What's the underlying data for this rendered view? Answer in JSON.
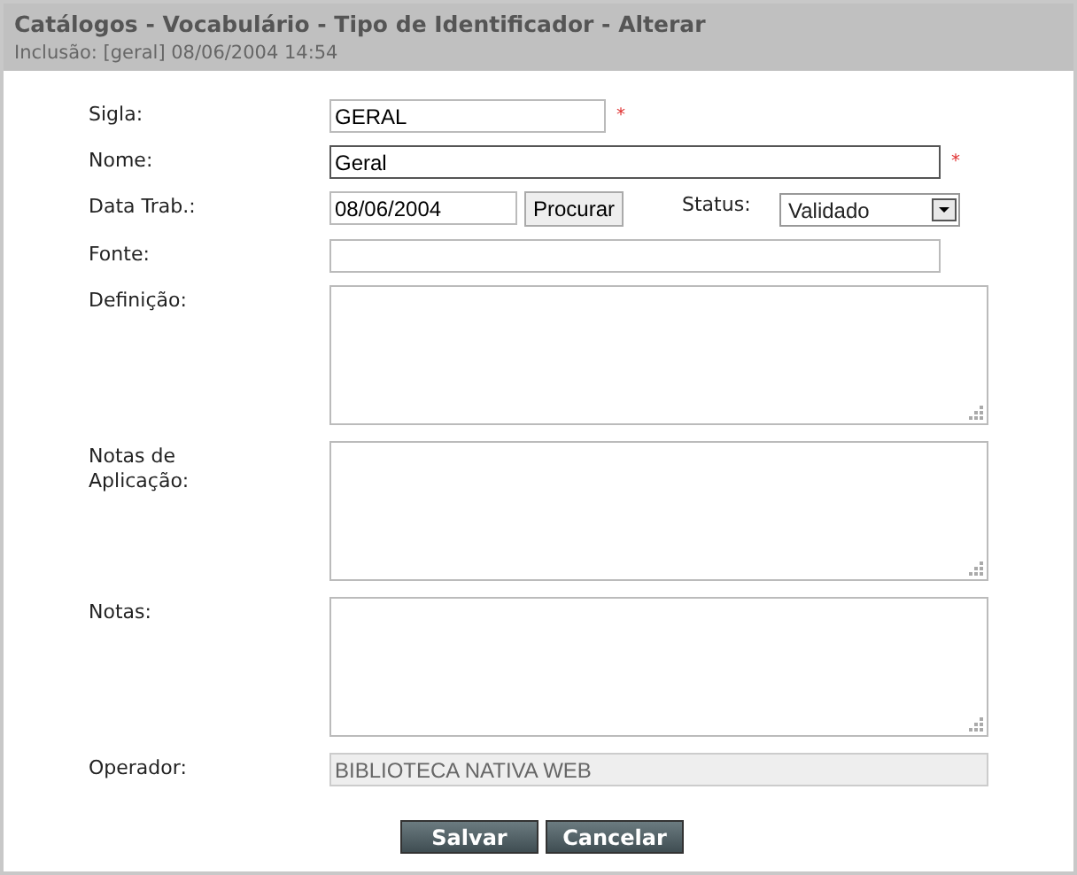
{
  "header": {
    "title": "Catálogos - Vocabulário - Tipo de Identificador - Alterar",
    "subtitle": "Inclusão: [geral] 08/06/2004 14:54"
  },
  "fields": [
    {
      "kind": "short",
      "label": "Sigla:",
      "value": "GERAL",
      "required": true,
      "required_mark": "*"
    },
    {
      "kind": "long",
      "label": "Nome:",
      "value": "Geral",
      "required": true,
      "required_mark": "*",
      "focused": true
    },
    {
      "kind": "date",
      "label": "Data Trab.:",
      "value": "08/06/2004",
      "button": "Procurar",
      "status_label": "Status:",
      "status_value": "Validado"
    },
    {
      "kind": "long",
      "label": "Fonte:",
      "focused": false
    },
    {
      "kind": "area",
      "label": "Definição:"
    },
    {
      "kind": "area",
      "label": "Notas de Aplicação:"
    },
    {
      "kind": "area",
      "label": "Notas:"
    },
    {
      "kind": "readonly",
      "label": "Operador:",
      "value": "BIBLIOTECA NATIVA WEB"
    }
  ],
  "buttons": [
    "Salvar",
    "Cancelar"
  ]
}
